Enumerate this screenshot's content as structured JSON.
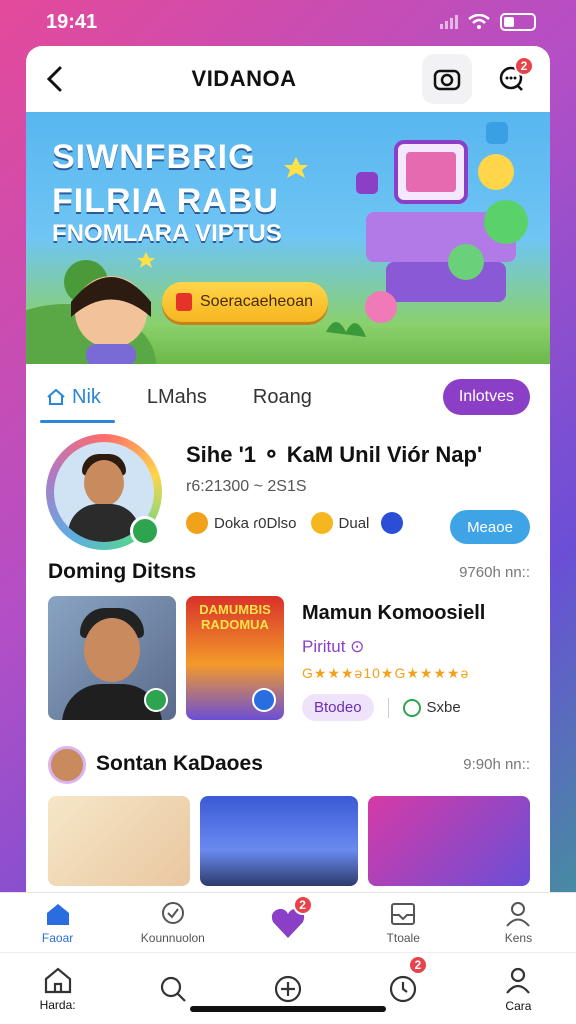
{
  "status_bar": {
    "time": "19:41"
  },
  "header": {
    "title": "VIDANOA",
    "notification_count": "2"
  },
  "hero": {
    "line1": "SIWNFBRIG",
    "line2": "FILRIA RABU",
    "line3": "FNOMLARA VIPTUS",
    "cta_label": "Soeracaeheoan"
  },
  "tabs": [
    {
      "label": "Nik"
    },
    {
      "label": "LMahs"
    },
    {
      "label": "Roang"
    }
  ],
  "tab_pill": "Inlotves",
  "profile": {
    "name": "Sihe '1 ⚬ KaM Unil Viór Nap'",
    "subtitle": "r6:21300 ~ 2S1S",
    "stat1": "Doka ɾ0Dlso",
    "stat2": "Dual",
    "button_label": "Meaoe"
  },
  "section1": {
    "title": "Doming Ditsns",
    "meta": "9760h nn::"
  },
  "feature": {
    "poster_text": "DAMUMBIS RADOMUA",
    "title": "Mamun Komoosiell",
    "subtitle": "Piritut ⊙",
    "rating": "G★★★ǝ10★G★★★★ǝ",
    "chip": "Btodeo",
    "secondary": "Sxbe"
  },
  "section2": {
    "title": "Sontan KaDaoes",
    "meta": "9:90h nn::"
  },
  "tabbar_top": [
    {
      "label": "Faoar",
      "icon": "home-icon"
    },
    {
      "label": "Kounnuolon",
      "icon": "chat-icon"
    },
    {
      "label": "",
      "icon": "heart-icon",
      "badge": "2"
    },
    {
      "label": "Ttoale",
      "icon": "inbox-icon"
    },
    {
      "label": "Kens",
      "icon": "user-icon"
    }
  ],
  "tabbar_bottom": [
    {
      "label": "Harda:",
      "icon": "home-outline-icon"
    },
    {
      "label": "",
      "icon": "search-icon"
    },
    {
      "label": "",
      "icon": "add-icon"
    },
    {
      "label": "",
      "icon": "notification-icon",
      "badge": "2"
    },
    {
      "label": "Cara",
      "icon": "profile-icon"
    }
  ],
  "colors": {
    "accent": "#2a6de0",
    "purple": "#8b3fc7",
    "badge": "#e8424a"
  }
}
